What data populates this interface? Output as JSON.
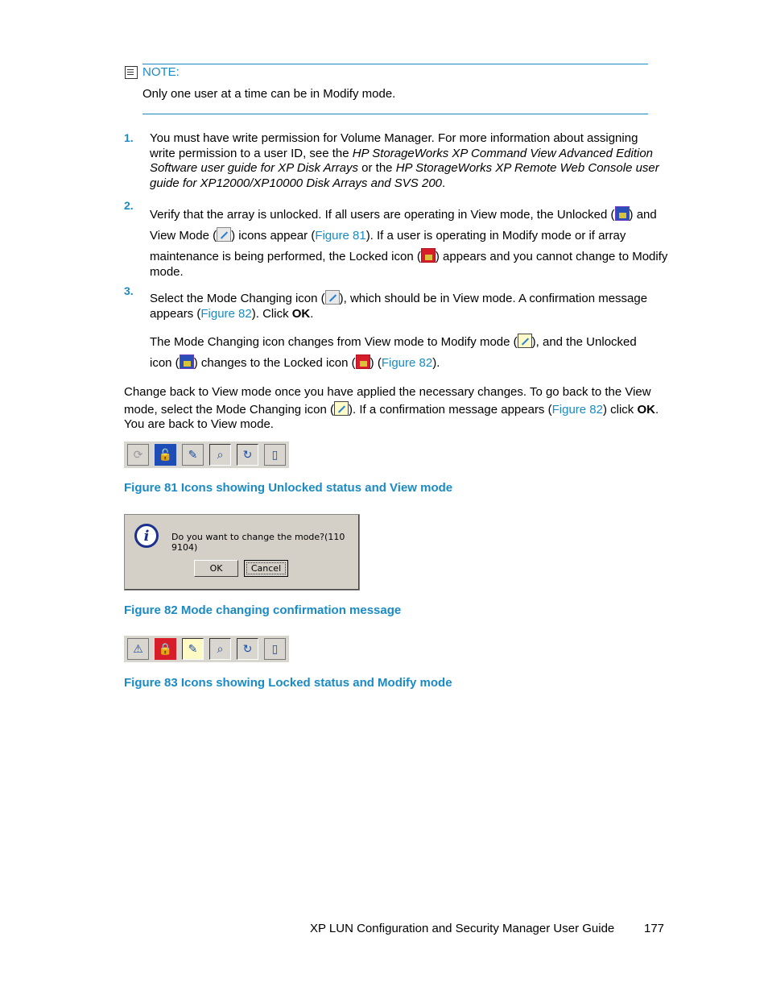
{
  "note": {
    "heading": "NOTE:",
    "text": "Only one user at a time can be in Modify mode."
  },
  "steps": [
    {
      "num": "1.",
      "lines": [
        "You must have write permission for Volume Manager. For more information about assigning",
        "write permission to a user ID, see the ",
        "HP StorageWorks XP Command View Advanced Edition",
        "Software user guide for XP Disk Arrays",
        " or the ",
        "HP StorageWorks XP Remote Web Console user",
        "guide for XP12000/XP10000 Disk Arrays and SVS 200",
        "."
      ]
    },
    {
      "num": "2.",
      "a": "Verify that the array is unlocked. If all users are operating in View mode, the Unlocked (",
      "b": ") and",
      "c": "View Mode (",
      "d": ") icons appear (",
      "link1": "Figure 81",
      "e": "). If a user is operating in Modify mode or if array",
      "f": "maintenance is being performed, the Locked icon (",
      "g": ") appears and you cannot change to Modify",
      "h": "mode."
    },
    {
      "num": "3.",
      "a": "Select the Mode Changing icon (",
      "b": "), which should be in View mode. A confirmation message",
      "c": "appears (",
      "link": "Figure 82",
      "d": "). Click ",
      "ok": "OK",
      "e": ".",
      "p2a": "The Mode Changing icon changes from View mode to Modify mode (",
      "p2b": "), and the Unlocked",
      "p2c": "icon (",
      "p2d": ") changes to the Locked icon (",
      "p2e": ") (",
      "p2link": "Figure 82",
      "p2f": ")."
    }
  ],
  "para": {
    "a": "Change back to View mode once you have applied the necessary changes. To go back to the View",
    "b": "mode, select the Mode Changing icon (",
    "c": "). If a confirmation message appears (",
    "link": "Figure 82",
    "d": ") click ",
    "ok": "OK",
    "e": ".",
    "f": "You are back to View mode."
  },
  "fig81": {
    "caption": "Figure 81 Icons showing Unlocked status and View mode",
    "icons": [
      "refresh-warning-disabled",
      "unlocked",
      "view-mode",
      "search-folder",
      "refresh-folder",
      "exit"
    ]
  },
  "fig82": {
    "caption": "Figure 82 Mode changing confirmation message",
    "message": "Do you want to change the mode?(110 9104)",
    "ok": "OK",
    "cancel": "Cancel"
  },
  "fig83": {
    "caption": "Figure 83 Icons showing Locked status and Modify mode",
    "icons": [
      "refresh-warning",
      "locked",
      "modify-mode",
      "search-folder",
      "refresh-folder",
      "exit"
    ]
  },
  "footer": {
    "title": "XP LUN Configuration and Security Manager User Guide",
    "page": "177"
  }
}
